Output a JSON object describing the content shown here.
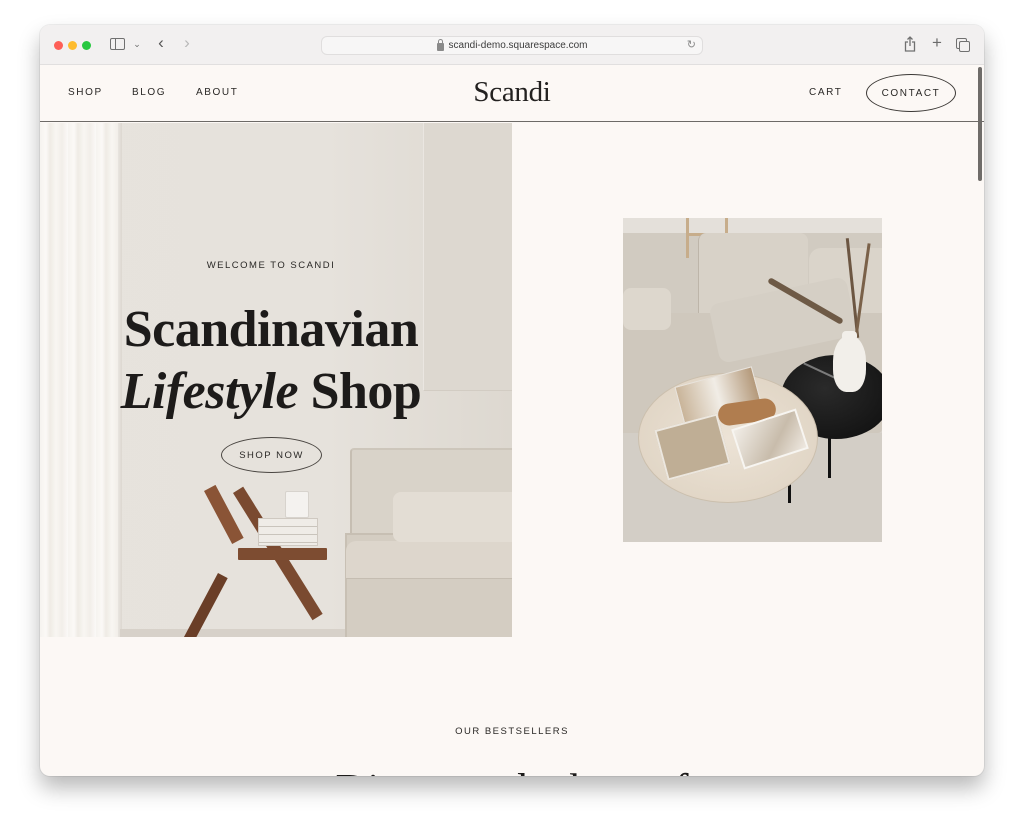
{
  "browser": {
    "url": "scandi-demo.squarespace.com",
    "icons": {
      "close": "traffic-light-close",
      "minimize": "traffic-light-minimize",
      "zoom": "traffic-light-zoom",
      "sidebar": "sidebar-toggle-icon",
      "sidebar_menu": "chevron-down-icon",
      "back": "chevron-left-icon",
      "forward": "chevron-right-icon",
      "lock": "lock-icon",
      "reload": "reload-icon",
      "share": "share-icon",
      "new_tab": "plus-icon",
      "tab_overview": "tabs-icon"
    },
    "glyphs": {
      "sidebar_menu": "⌄",
      "back": "‹",
      "forward": "›",
      "reload": "↻",
      "new_tab": "+"
    }
  },
  "site": {
    "logo": "Scandi",
    "nav_left": [
      {
        "label": "SHOP"
      },
      {
        "label": "BLOG"
      },
      {
        "label": "ABOUT"
      }
    ],
    "nav_right": {
      "cart": "CART",
      "contact": "CONTACT"
    },
    "colors": {
      "background": "#fcf8f5",
      "text": "#1d1b1a",
      "border": "#3b3835"
    }
  },
  "hero": {
    "eyebrow": "WELCOME TO SCANDI",
    "headline_line1": "Scandinavian",
    "headline_italic": "Lifestyle",
    "headline_rest": " Shop",
    "cta": "SHOP NOW",
    "left_image": "interior-chair-sofa-photo",
    "right_image": "living-room-coffee-tables-photo"
  },
  "bestsellers": {
    "eyebrow": "OUR BESTSELLERS",
    "heading_partial": "Discover the best of"
  }
}
